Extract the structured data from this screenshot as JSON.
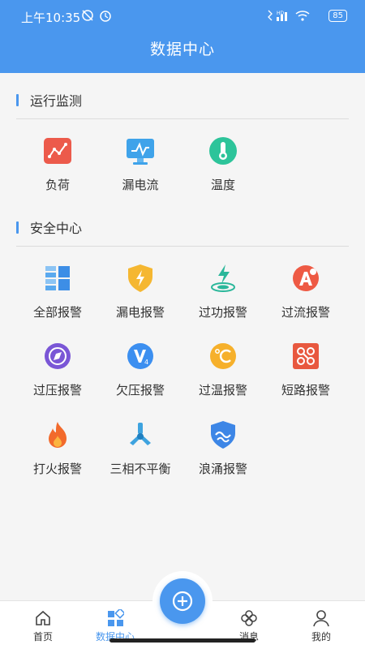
{
  "status": {
    "time": "上午10:35",
    "battery": "85",
    "network": "HD"
  },
  "header": {
    "title": "数据中心"
  },
  "sections": [
    {
      "title": "运行监测",
      "items": [
        {
          "label": "负荷",
          "icon": "load-chart-icon"
        },
        {
          "label": "漏电流",
          "icon": "leakage-monitor-icon"
        },
        {
          "label": "温度",
          "icon": "thermometer-icon"
        }
      ]
    },
    {
      "title": "安全中心",
      "items": [
        {
          "label": "全部报警",
          "icon": "grid-icon"
        },
        {
          "label": "漏电报警",
          "icon": "shield-lightning-icon"
        },
        {
          "label": "过功报警",
          "icon": "power-lightning-icon"
        },
        {
          "label": "过流报警",
          "icon": "overcurrent-icon"
        },
        {
          "label": "过压报警",
          "icon": "compass-icon"
        },
        {
          "label": "欠压报警",
          "icon": "undervoltage-icon"
        },
        {
          "label": "过温报警",
          "icon": "celsius-icon"
        },
        {
          "label": "短路报警",
          "icon": "short-circuit-icon"
        },
        {
          "label": "打火报警",
          "icon": "flame-icon"
        },
        {
          "label": "三相不平衡",
          "icon": "three-phase-icon"
        },
        {
          "label": "浪涌报警",
          "icon": "surge-shield-icon"
        }
      ]
    }
  ],
  "tabs": [
    {
      "label": "首页",
      "icon": "home-icon"
    },
    {
      "label": "数据中心",
      "icon": "data-center-icon",
      "active": true
    },
    {
      "label": "消息",
      "icon": "clover-icon"
    },
    {
      "label": "我的",
      "icon": "user-icon"
    }
  ],
  "colors": {
    "primary": "#4a97ee",
    "background": "#f5f5f5"
  }
}
